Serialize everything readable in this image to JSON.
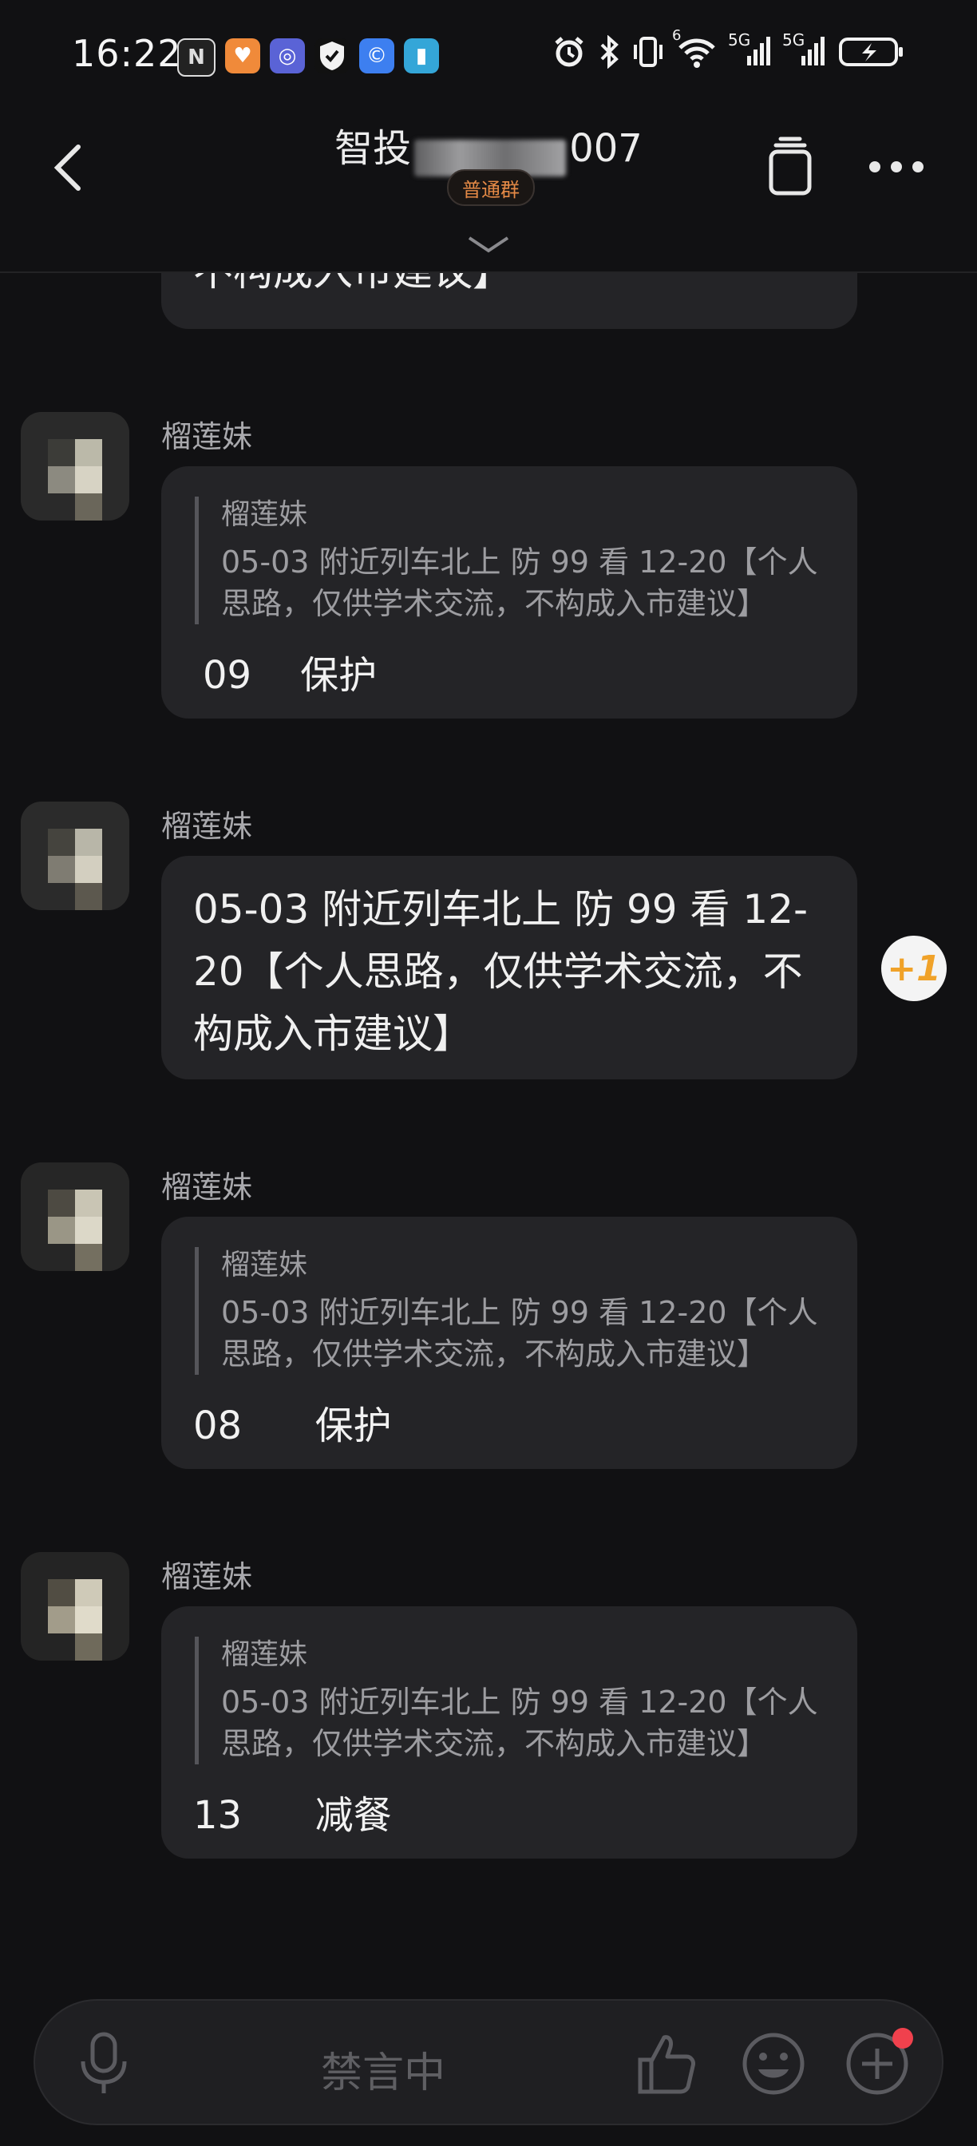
{
  "status_bar": {
    "time": "16:22",
    "signal_1": "5G",
    "signal_2": "5G",
    "wifi_badge": "6"
  },
  "header": {
    "title_prefix": "智投",
    "title_suffix": "007",
    "badge": "普通群"
  },
  "messages": {
    "top_partial": "不构成入市建议】",
    "m1": {
      "sender": "榴莲妹",
      "quote_sender": "榴莲妹",
      "quote_text": "05-03 附近列车北上  防 99  看  12-20【个人思路，仅供学术交流，不构成入市建议】",
      "reply": "09    保护"
    },
    "m2": {
      "sender": "榴莲妹",
      "text": "05-03 附近列车北上  防 99  看  12-20【个人思路，仅供学术交流，不构成入市建议】",
      "plus_one": "+1"
    },
    "m3": {
      "sender": "榴莲妹",
      "quote_sender": "榴莲妹",
      "quote_text": "05-03 附近列车北上  防 99  看  12-20【个人思路，仅供学术交流，不构成入市建议】",
      "reply": "08      保护"
    },
    "m4": {
      "sender": "榴莲妹",
      "quote_sender": "榴莲妹",
      "quote_text": "05-03 附近列车北上  防 99  看  12-20【个人思路，仅供学术交流，不构成入市建议】",
      "reply": "13      减餐"
    }
  },
  "input_bar": {
    "muted_text": "禁言中"
  },
  "colors": {
    "background": "#111113",
    "bubble": "#242427",
    "badge_text": "#e58a46",
    "plus_one": "#f0a229",
    "notify_dot": "#f0414d"
  },
  "icons": [
    "back-arrow-icon",
    "copy-icon",
    "more-icon",
    "chevron-down-icon",
    "mic-icon",
    "thumb-up-icon",
    "emoji-icon",
    "plus-circle-icon",
    "alarm-icon",
    "bluetooth-icon",
    "vibrate-icon",
    "wifi-icon",
    "signal-icon",
    "battery-icon"
  ]
}
